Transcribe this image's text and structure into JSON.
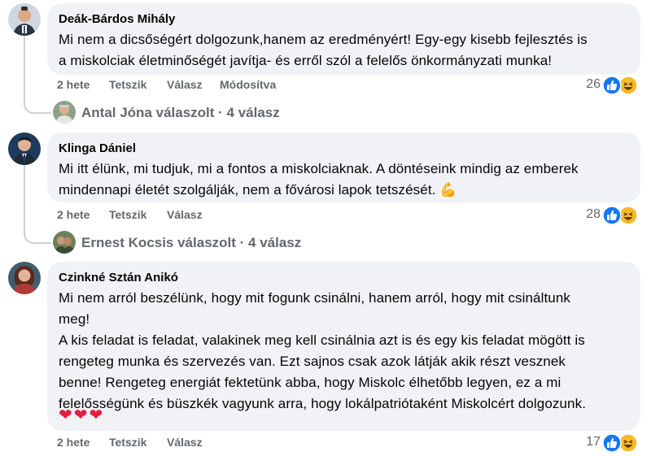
{
  "comments": [
    {
      "author": "Deák-Bárdos Mihály",
      "lines": [
        "Mi nem a dicsőségért dolgozunk,hanem az eredményért! Egy-egy kisebb fejlesztés is",
        "a miskolciak életminőségét javítja- és erről szól a felelős önkormányzati munka!"
      ],
      "time": "2 hete",
      "like_label": "Tetszik",
      "reply_label": "Válasz",
      "edited_label": "Módosítva",
      "reaction_count": "26",
      "replies_text": "Antal Jóna válaszolt · 4 válasz"
    },
    {
      "author": "Klinga Dániel",
      "lines": [
        "Mi itt élünk, mi tudjuk, mi a fontos a miskolciaknak. A döntéseink mindig az emberek",
        "mindennapi életét szolgálják, nem a fővárosi lapok tetszését. 💪"
      ],
      "time": "2 hete",
      "like_label": "Tetszik",
      "reply_label": "Válasz",
      "reaction_count": "28",
      "replies_text": "Ernest Kocsis válaszolt · 4 válasz"
    },
    {
      "author": "Czinkné Sztán Anikó",
      "lines": [
        "Mi nem arról beszélünk, hogy mit fogunk csinálni, hanem arról, hogy mit csináltunk",
        "meg!",
        "A kis feladat is feladat, valakinek meg kell csinálnia azt is és egy kis feladat mögött is",
        "rengeteg munka és szervezés van. Ezt sajnos csak azok látják akik részt vesznek",
        "benne! Rengeteg energiát fektetünk abba, hogy Miskolc élhetőbb legyen, ez a mi",
        "felelősségünk és büszkék vagyunk arra, hogy lokálpatriótaként Miskolcért dolgozunk."
      ],
      "emojis": "❤❤❤",
      "time": "2 hete",
      "like_label": "Tetszik",
      "reply_label": "Válasz",
      "reaction_count": "17"
    }
  ],
  "colors": {
    "bubble": "#f0f2f5",
    "muted": "#65676b",
    "like_blue": "#1877f2",
    "haha_yellow": "#f7b928"
  },
  "icons": [
    "like-reaction-icon",
    "haha-reaction-icon"
  ]
}
